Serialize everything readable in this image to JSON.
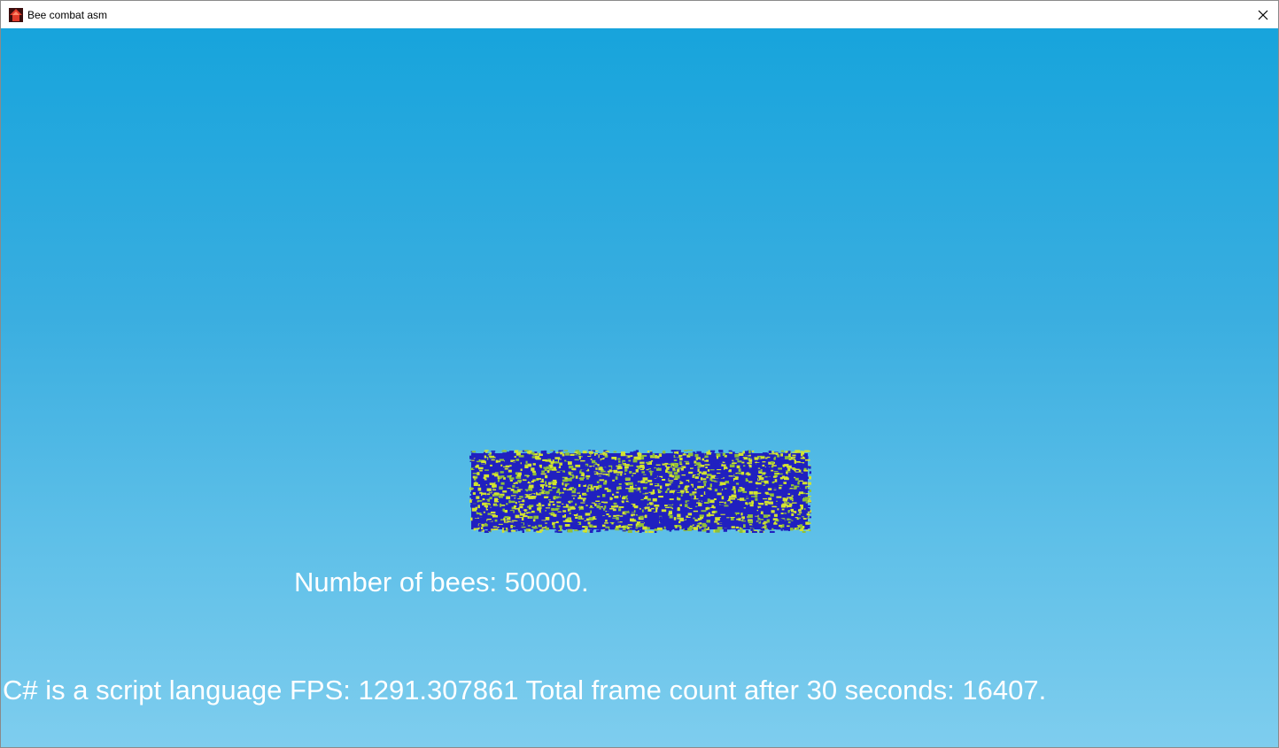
{
  "window": {
    "title": "Bee combat asm",
    "app_icon": "house-icon",
    "close_icon": "close-icon"
  },
  "scene": {
    "sky_colors": [
      "#17a4dc",
      "#7ecdee"
    ],
    "team_colors": [
      "#2020c0",
      "#d4e430",
      "#8fbf3a"
    ]
  },
  "hud": {
    "bee_count_text": "Number of bees: 50000.",
    "fps_text": "C# is a script language FPS: 1291.307861 Total frame count after 30 seconds: 16407."
  }
}
